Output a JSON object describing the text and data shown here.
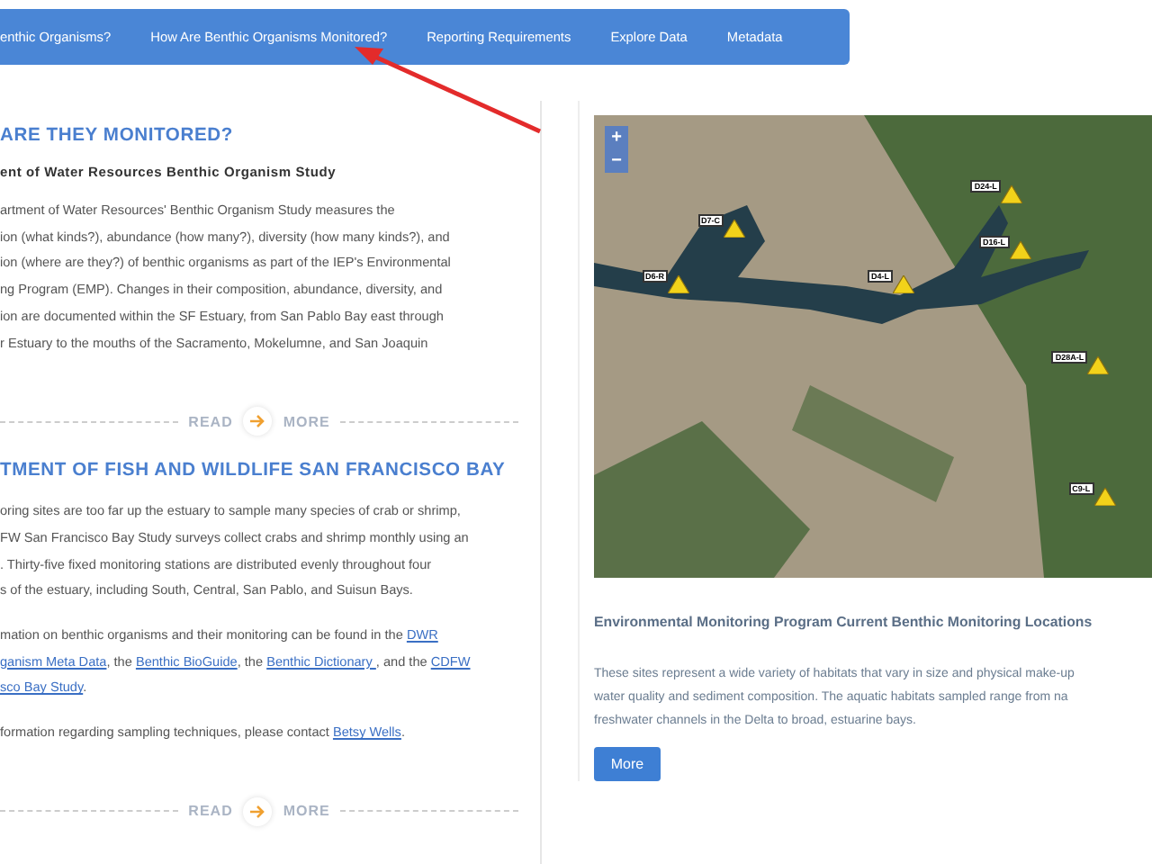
{
  "nav": [
    {
      "label": "enthic Organisms?"
    },
    {
      "label": "How Are Benthic Organisms Monitored?"
    },
    {
      "label": "Reporting Requirements"
    },
    {
      "label": "Explore Data"
    },
    {
      "label": "Metadata"
    }
  ],
  "sections": [
    {
      "heading": "ARE THEY MONITORED?",
      "subheading": "ent of Water Resources Benthic Organism Study",
      "paragraphs": [
        [
          [
            {
              "text": "artment of Water Resources' Benthic Organism Study measures the",
              "link": false
            }
          ],
          [
            {
              "text": "ion (what kinds?), abundance (how many?), diversity (how many kinds?), and",
              "link": false
            }
          ],
          [
            {
              "text": "ion (where are they?) of benthic organisms as part of the IEP's Environmental",
              "link": false
            }
          ],
          [
            {
              "text": "ng Program (EMP). Changes in their composition, abundance, diversity, and",
              "link": false
            }
          ],
          [
            {
              "text": "ion are documented within the SF Estuary, from San Pablo Bay east through",
              "link": false
            }
          ],
          [
            {
              "text": "r Estuary to the mouths of the Sacramento, Mokelumne, and San Joaquin",
              "link": false
            }
          ]
        ]
      ],
      "read_more": {
        "left": "READ",
        "right": "MORE"
      }
    },
    {
      "heading": "TMENT OF FISH AND WILDLIFE SAN FRANCISCO BAY",
      "paragraphs": [
        [
          [
            {
              "text": "oring sites are too far up the estuary to sample many species of crab or shrimp,",
              "link": false
            }
          ],
          [
            {
              "text": "FW San Francisco Bay Study surveys collect crabs and shrimp monthly using an",
              "link": false
            }
          ],
          [
            {
              "text": ". Thirty-five fixed monitoring stations are distributed evenly throughout four",
              "link": false
            }
          ],
          [
            {
              "text": "s of the estuary, including South, Central, San Pablo, and Suisun Bays.",
              "link": false
            }
          ]
        ],
        [
          [
            {
              "text": "mation on benthic organisms and their monitoring can be found in the ",
              "link": false
            },
            {
              "text": "DWR",
              "link": true
            }
          ],
          [
            {
              "text": "ganism Meta Data",
              "link": true
            },
            {
              "text": ", the ",
              "link": false
            },
            {
              "text": "Benthic BioGuide",
              "link": true
            },
            {
              "text": ", the ",
              "link": false
            },
            {
              "text": "Benthic Dictionary ",
              "link": true
            },
            {
              "text": ", and the ",
              "link": false
            },
            {
              "text": "CDFW",
              "link": true
            }
          ],
          [
            {
              "text": "sco Bay Study",
              "link": true
            },
            {
              "text": ".",
              "link": false
            }
          ]
        ],
        [
          [
            {
              "text": "formation regarding sampling techniques, please contact ",
              "link": false
            },
            {
              "text": "Betsy Wells",
              "link": true
            },
            {
              "text": ".",
              "link": false
            }
          ]
        ]
      ],
      "read_more": {
        "left": "READ",
        "right": "MORE"
      }
    }
  ],
  "map": {
    "zoom_in": "+",
    "zoom_out": "−",
    "stations": [
      {
        "label": "D7-C"
      },
      {
        "label": "D6-R"
      },
      {
        "label": "D4-L"
      },
      {
        "label": "D24-L"
      },
      {
        "label": "D16-L"
      },
      {
        "label": "D28A-L"
      },
      {
        "label": "C9-L"
      }
    ]
  },
  "caption": {
    "title": "Environmental Monitoring Program Current Benthic Monitoring Locations",
    "lines": [
      "These sites represent a wide variety of habitats that vary in size and physical make-up",
      "water quality and sediment composition. The aquatic habitats sampled range from na",
      "freshwater channels in the Delta to broad, estuarine bays."
    ],
    "button": "More"
  }
}
